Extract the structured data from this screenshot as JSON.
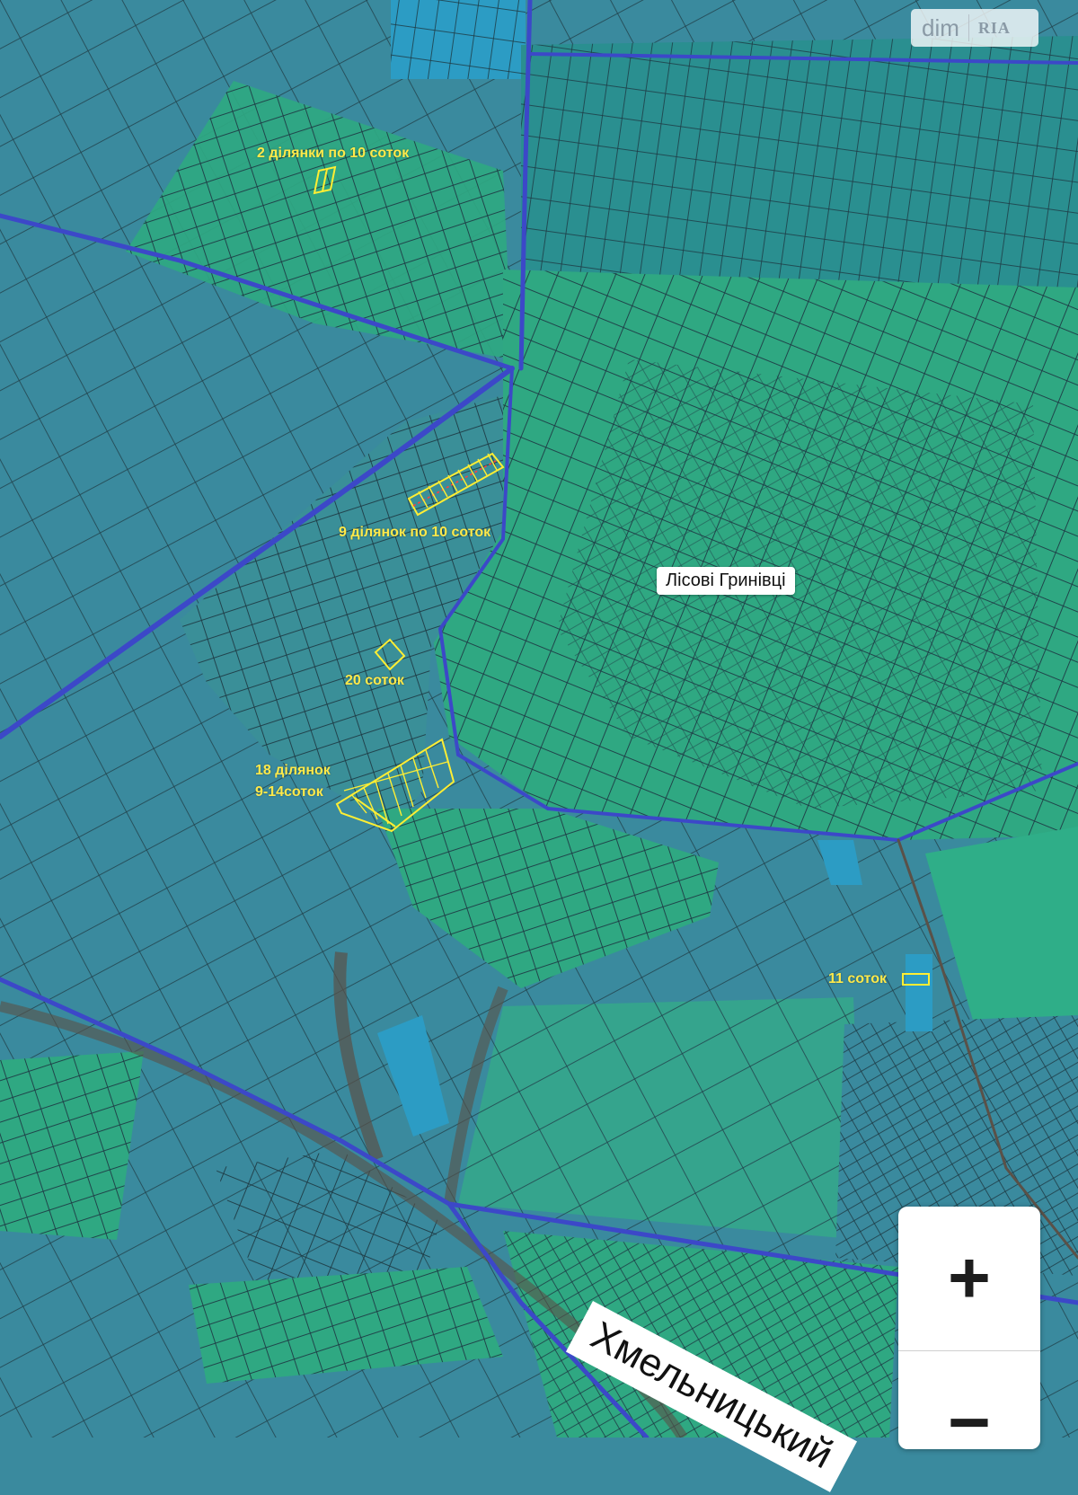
{
  "watermark": {
    "brand": "dim",
    "brand_suffix": "RIA"
  },
  "map": {
    "place_name": "Лісові Гринівці",
    "city_name": "Хмельницький",
    "plot_labels": {
      "two_plots": "2 ділянки по 10 соток",
      "nine_plots": "9 ділянок по 10 соток",
      "twenty": "20 соток",
      "eighteen_line1": "18 ділянок",
      "eighteen_line2": "9-14соток",
      "eleven": "11 соток"
    },
    "colors": {
      "field": "#3a8a9e",
      "garden": "#2fa882",
      "road": "#3c48c8",
      "highlight": "#ffee33",
      "plot_line": "#1d3a44"
    }
  },
  "controls": {
    "zoom_in_icon": "plus-icon",
    "zoom_out_icon": "minus-icon",
    "zoom_in": "+",
    "zoom_out": "−"
  }
}
